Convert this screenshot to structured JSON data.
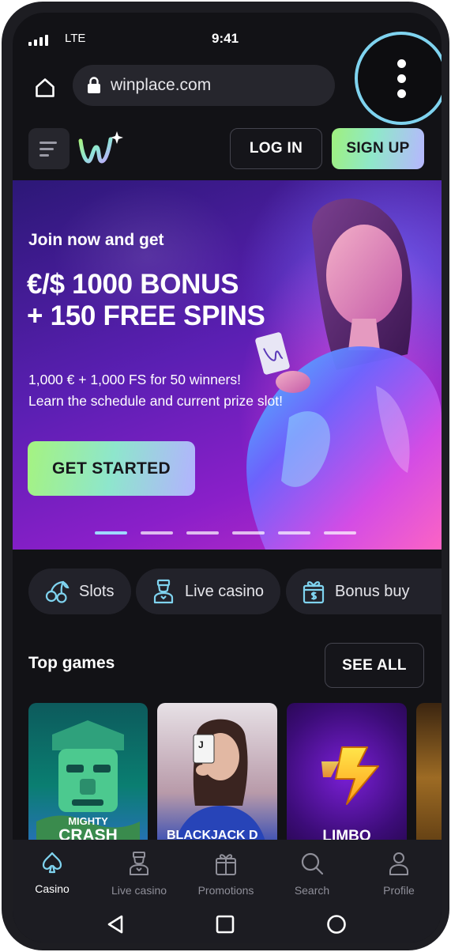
{
  "status_bar": {
    "network": "LTE",
    "time": "9:41"
  },
  "browser": {
    "url": "winplace.com",
    "home_icon": "home-icon",
    "lock_icon": "lock-icon",
    "menu_icon": "more-vertical-icon"
  },
  "header": {
    "login_label": "LOG IN",
    "signup_label": "SIGN UP",
    "logo_icon": "winplace-logo",
    "menu_icon": "hamburger-icon"
  },
  "hero": {
    "intro": "Join now and get",
    "title_line1": "€/$ 1000 BONUS",
    "title_line2": "+ 150 FREE SPINS",
    "sub_line1": "1,000 € + 1,000 FS for 50 winners!",
    "sub_line2": "Learn the schedule and current prize slot!",
    "cta_label": "GET STARTED",
    "slide_count": 6,
    "active_slide": 1
  },
  "categories": [
    {
      "label": "Slots",
      "icon": "cherries-icon"
    },
    {
      "label": "Live casino",
      "icon": "dealer-icon"
    },
    {
      "label": "Bonus buy",
      "icon": "gift-dollar-icon"
    }
  ],
  "top_games": {
    "title": "Top games",
    "see_all_label": "SEE ALL",
    "games": [
      {
        "line1": "MIGHTY",
        "line2": "CRASH"
      },
      {
        "line1": "BLACKJACK D"
      },
      {
        "line1": "LIMBO"
      }
    ]
  },
  "bottom_nav": [
    {
      "label": "Casino",
      "icon": "spade-icon",
      "active": true
    },
    {
      "label": "Live casino",
      "icon": "dealer-icon",
      "active": false
    },
    {
      "label": "Promotions",
      "icon": "gift-icon",
      "active": false
    },
    {
      "label": "Search",
      "icon": "search-icon",
      "active": false
    },
    {
      "label": "Profile",
      "icon": "user-icon",
      "active": false
    }
  ],
  "system_nav": {
    "back_icon": "back-triangle-icon",
    "home_icon": "home-square-icon",
    "recents_icon": "circle-icon"
  },
  "colors": {
    "background": "#121216",
    "accent_green": "#9ff07d",
    "accent_lavender": "#b7b6ff",
    "highlight_ring": "#7fd3ef"
  }
}
